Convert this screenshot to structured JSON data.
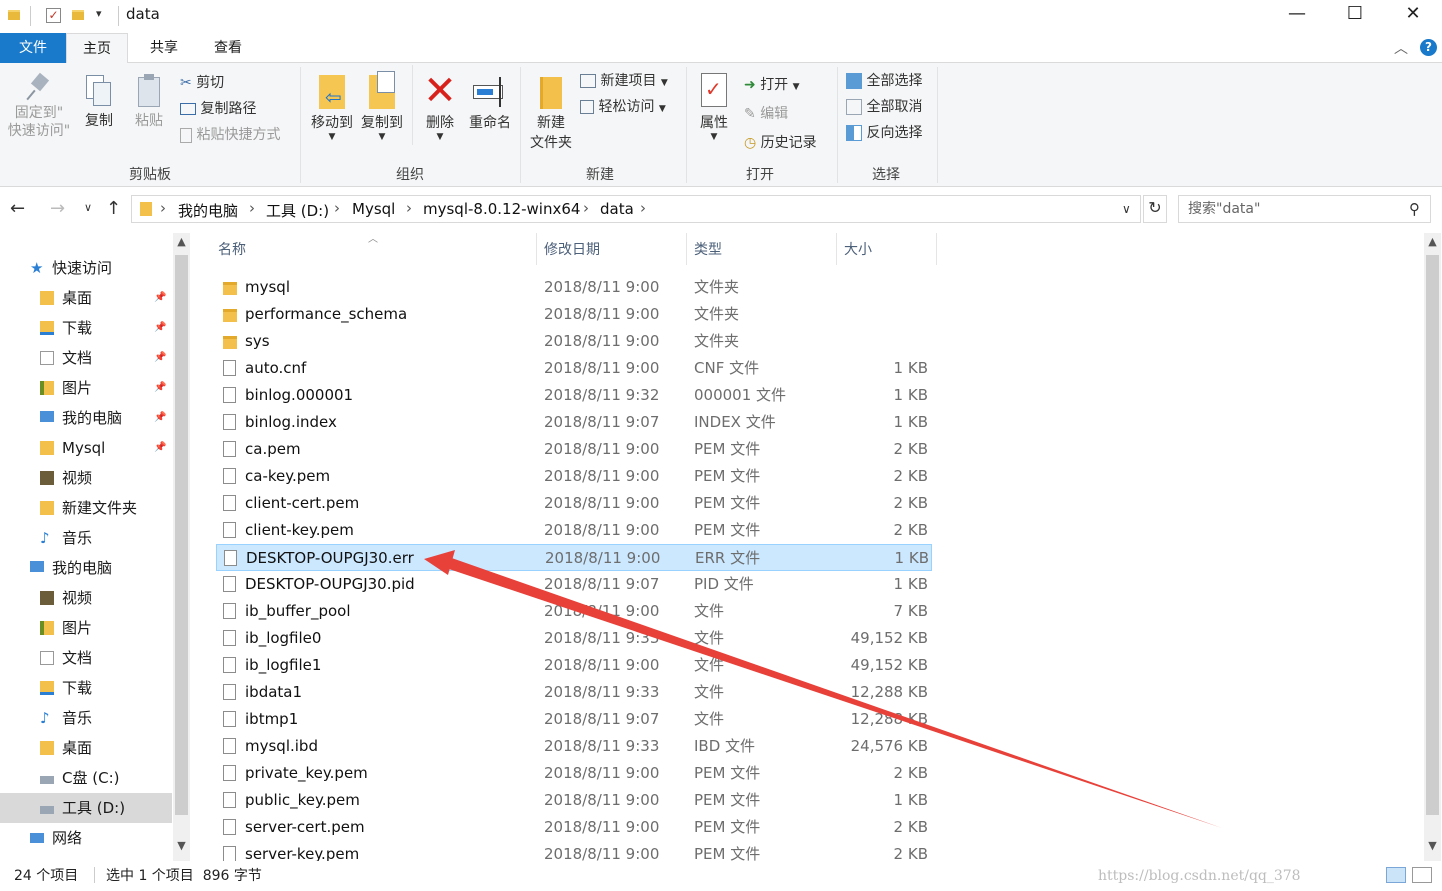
{
  "window": {
    "title": "data",
    "controls": {
      "minimize": "—",
      "maximize": "☐",
      "close": "✕"
    }
  },
  "tabs": {
    "file": "文件",
    "home": "主页",
    "share": "共享",
    "view": "查看"
  },
  "ribbon": {
    "clipboard": {
      "label": "剪贴板",
      "pin_line1": "固定到\"",
      "pin_line2": "快速访问\"",
      "copy": "复制",
      "paste": "粘贴",
      "cut": "剪切",
      "copy_path": "复制路径",
      "paste_shortcut": "粘贴快捷方式"
    },
    "organize": {
      "label": "组织",
      "move_to": "移动到",
      "copy_to": "复制到",
      "delete": "删除",
      "rename": "重命名"
    },
    "new": {
      "label": "新建",
      "new_folder_line1": "新建",
      "new_folder_line2": "文件夹",
      "new_item": "新建项目",
      "easy_access": "轻松访问"
    },
    "open": {
      "label": "打开",
      "properties": "属性",
      "open": "打开",
      "edit": "编辑",
      "history": "历史记录"
    },
    "select": {
      "label": "选择",
      "select_all": "全部选择",
      "select_none": "全部取消",
      "invert": "反向选择"
    }
  },
  "address": {
    "crumbs": [
      "我的电脑",
      "工具 (D:)",
      "Mysql",
      "mysql-8.0.12-winx64",
      "data"
    ],
    "search_placeholder": "搜索\"data\""
  },
  "nav_pane": {
    "items": [
      {
        "label": "快速访问",
        "level": 0,
        "pinned": false,
        "selected": false,
        "icon": "star-icon"
      },
      {
        "label": "桌面",
        "level": 1,
        "pinned": true,
        "selected": false,
        "icon": "folder-icon"
      },
      {
        "label": "下载",
        "level": 1,
        "pinned": true,
        "selected": false,
        "icon": "download-icon"
      },
      {
        "label": "文档",
        "level": 1,
        "pinned": true,
        "selected": false,
        "icon": "document-icon"
      },
      {
        "label": "图片",
        "level": 1,
        "pinned": true,
        "selected": false,
        "icon": "picture-icon"
      },
      {
        "label": "我的电脑",
        "level": 1,
        "pinned": true,
        "selected": false,
        "icon": "computer-icon"
      },
      {
        "label": "Mysql",
        "level": 1,
        "pinned": true,
        "selected": false,
        "icon": "folder-icon"
      },
      {
        "label": "视频",
        "level": 1,
        "pinned": false,
        "selected": false,
        "icon": "video-icon"
      },
      {
        "label": "新建文件夹",
        "level": 1,
        "pinned": false,
        "selected": false,
        "icon": "folder-icon"
      },
      {
        "label": "音乐",
        "level": 1,
        "pinned": false,
        "selected": false,
        "icon": "music-icon"
      },
      {
        "label": "我的电脑",
        "level": 0,
        "pinned": false,
        "selected": false,
        "icon": "computer-icon"
      },
      {
        "label": "视频",
        "level": 1,
        "pinned": false,
        "selected": false,
        "icon": "video-icon"
      },
      {
        "label": "图片",
        "level": 1,
        "pinned": false,
        "selected": false,
        "icon": "picture-icon"
      },
      {
        "label": "文档",
        "level": 1,
        "pinned": false,
        "selected": false,
        "icon": "document-icon"
      },
      {
        "label": "下载",
        "level": 1,
        "pinned": false,
        "selected": false,
        "icon": "download-icon"
      },
      {
        "label": "音乐",
        "level": 1,
        "pinned": false,
        "selected": false,
        "icon": "music-icon"
      },
      {
        "label": "桌面",
        "level": 1,
        "pinned": false,
        "selected": false,
        "icon": "folder-icon"
      },
      {
        "label": "C盘 (C:)",
        "level": 1,
        "pinned": false,
        "selected": false,
        "icon": "drive-icon"
      },
      {
        "label": "工具 (D:)",
        "level": 1,
        "pinned": false,
        "selected": true,
        "icon": "drive-icon"
      },
      {
        "label": "网络",
        "level": 0,
        "pinned": false,
        "selected": false,
        "icon": "network-icon"
      }
    ]
  },
  "columns": {
    "name": "名称",
    "date": "修改日期",
    "type": "类型",
    "size": "大小"
  },
  "files": [
    {
      "name": "mysql",
      "date": "2018/8/11 9:00",
      "type": "文件夹",
      "size": "",
      "kind": "folder"
    },
    {
      "name": "performance_schema",
      "date": "2018/8/11 9:00",
      "type": "文件夹",
      "size": "",
      "kind": "folder"
    },
    {
      "name": "sys",
      "date": "2018/8/11 9:00",
      "type": "文件夹",
      "size": "",
      "kind": "folder"
    },
    {
      "name": "auto.cnf",
      "date": "2018/8/11 9:00",
      "type": "CNF 文件",
      "size": "1 KB",
      "kind": "doc"
    },
    {
      "name": "binlog.000001",
      "date": "2018/8/11 9:32",
      "type": "000001 文件",
      "size": "1 KB",
      "kind": "doc"
    },
    {
      "name": "binlog.index",
      "date": "2018/8/11 9:07",
      "type": "INDEX 文件",
      "size": "1 KB",
      "kind": "doc"
    },
    {
      "name": "ca.pem",
      "date": "2018/8/11 9:00",
      "type": "PEM 文件",
      "size": "2 KB",
      "kind": "doc"
    },
    {
      "name": "ca-key.pem",
      "date": "2018/8/11 9:00",
      "type": "PEM 文件",
      "size": "2 KB",
      "kind": "doc"
    },
    {
      "name": "client-cert.pem",
      "date": "2018/8/11 9:00",
      "type": "PEM 文件",
      "size": "2 KB",
      "kind": "doc"
    },
    {
      "name": "client-key.pem",
      "date": "2018/8/11 9:00",
      "type": "PEM 文件",
      "size": "2 KB",
      "kind": "doc"
    },
    {
      "name": "DESKTOP-OUPGJ30.err",
      "date": "2018/8/11 9:00",
      "type": "ERR 文件",
      "size": "1 KB",
      "kind": "doc",
      "selected": true
    },
    {
      "name": "DESKTOP-OUPGJ30.pid",
      "date": "2018/8/11 9:07",
      "type": "PID 文件",
      "size": "1 KB",
      "kind": "doc"
    },
    {
      "name": "ib_buffer_pool",
      "date": "2018/8/11 9:00",
      "type": "文件",
      "size": "7 KB",
      "kind": "doc"
    },
    {
      "name": "ib_logfile0",
      "date": "2018/8/11 9:33",
      "type": "文件",
      "size": "49,152 KB",
      "kind": "doc"
    },
    {
      "name": "ib_logfile1",
      "date": "2018/8/11 9:00",
      "type": "文件",
      "size": "49,152 KB",
      "kind": "doc"
    },
    {
      "name": "ibdata1",
      "date": "2018/8/11 9:33",
      "type": "文件",
      "size": "12,288 KB",
      "kind": "doc"
    },
    {
      "name": "ibtmp1",
      "date": "2018/8/11 9:07",
      "type": "文件",
      "size": "12,288 KB",
      "kind": "doc"
    },
    {
      "name": "mysql.ibd",
      "date": "2018/8/11 9:33",
      "type": "IBD 文件",
      "size": "24,576 KB",
      "kind": "doc"
    },
    {
      "name": "private_key.pem",
      "date": "2018/8/11 9:00",
      "type": "PEM 文件",
      "size": "2 KB",
      "kind": "doc"
    },
    {
      "name": "public_key.pem",
      "date": "2018/8/11 9:00",
      "type": "PEM 文件",
      "size": "1 KB",
      "kind": "doc"
    },
    {
      "name": "server-cert.pem",
      "date": "2018/8/11 9:00",
      "type": "PEM 文件",
      "size": "2 KB",
      "kind": "doc"
    },
    {
      "name": "server-key.pem",
      "date": "2018/8/11 9:00",
      "type": "PEM 文件",
      "size": "2 KB",
      "kind": "doc"
    }
  ],
  "status": {
    "item_count": "24 个项目",
    "selection": "选中 1 个项目  896 字节"
  },
  "watermark": "https://blog.csdn.net/qq_378",
  "colors": {
    "accent": "#1979ca",
    "selection": "#cce8ff",
    "annotation_arrow": "#e8413a"
  }
}
